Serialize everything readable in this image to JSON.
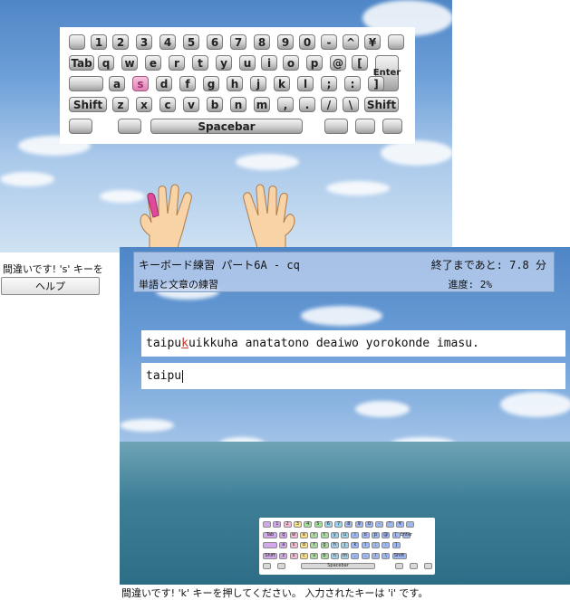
{
  "top_keyboard": {
    "rows": [
      [
        "",
        "1",
        "2",
        "3",
        "4",
        "5",
        "6",
        "7",
        "8",
        "9",
        "0",
        "-",
        "^",
        "¥",
        ""
      ],
      [
        "Tab",
        "q",
        "w",
        "e",
        "r",
        "t",
        "y",
        "u",
        "i",
        "o",
        "p",
        "@",
        "[",
        "Enter"
      ],
      [
        "",
        "a",
        "s",
        "d",
        "f",
        "g",
        "h",
        "j",
        "k",
        "l",
        ";",
        ":",
        "]"
      ],
      [
        "Shift",
        "z",
        "x",
        "c",
        "v",
        "b",
        "n",
        "m",
        ",",
        ".",
        "/",
        "\\",
        "Shift"
      ],
      [
        "",
        "",
        "Spacebar",
        "",
        "",
        ""
      ]
    ],
    "highlighted_key": "s"
  },
  "status_top": "間違いです! 's' キーを",
  "help_button": "ヘルプ",
  "lesson": {
    "title": "キーボード練習 パート6A - cq",
    "time_left": "終了まであと: 7.8 分",
    "subtitle": "単語と文章の練習",
    "progress": "進度: 2%"
  },
  "target_text": {
    "typed": "taipu",
    "current": "k",
    "remaining": "uikkuha anatatono deaiwo yorokonde imasu."
  },
  "input_text": "taipu",
  "status_bottom": "間違いです! 'k' キーを押してください。 入力されたキーは 'i' です。",
  "colors": {
    "highlight_key": "#e08ab8",
    "error_char": "#c0392b"
  }
}
